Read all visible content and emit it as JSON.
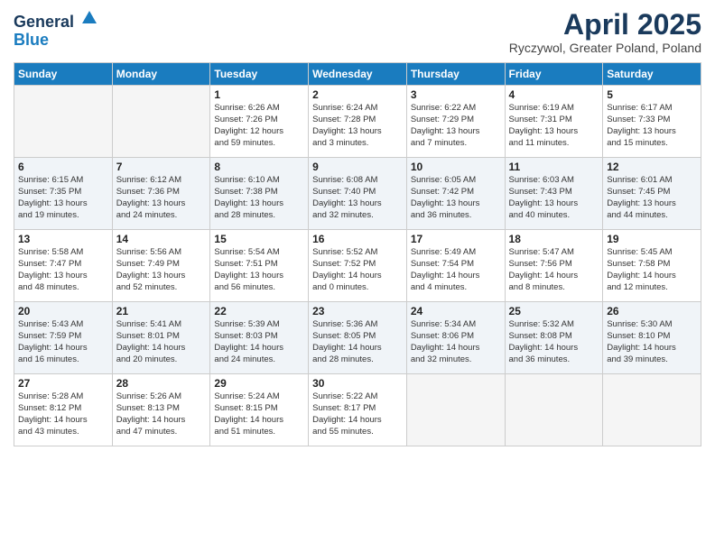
{
  "header": {
    "logo_general": "General",
    "logo_blue": "Blue",
    "month": "April 2025",
    "location": "Ryczywol, Greater Poland, Poland"
  },
  "weekdays": [
    "Sunday",
    "Monday",
    "Tuesday",
    "Wednesday",
    "Thursday",
    "Friday",
    "Saturday"
  ],
  "weeks": [
    [
      {
        "day": "",
        "lines": []
      },
      {
        "day": "",
        "lines": []
      },
      {
        "day": "1",
        "lines": [
          "Sunrise: 6:26 AM",
          "Sunset: 7:26 PM",
          "Daylight: 12 hours",
          "and 59 minutes."
        ]
      },
      {
        "day": "2",
        "lines": [
          "Sunrise: 6:24 AM",
          "Sunset: 7:28 PM",
          "Daylight: 13 hours",
          "and 3 minutes."
        ]
      },
      {
        "day": "3",
        "lines": [
          "Sunrise: 6:22 AM",
          "Sunset: 7:29 PM",
          "Daylight: 13 hours",
          "and 7 minutes."
        ]
      },
      {
        "day": "4",
        "lines": [
          "Sunrise: 6:19 AM",
          "Sunset: 7:31 PM",
          "Daylight: 13 hours",
          "and 11 minutes."
        ]
      },
      {
        "day": "5",
        "lines": [
          "Sunrise: 6:17 AM",
          "Sunset: 7:33 PM",
          "Daylight: 13 hours",
          "and 15 minutes."
        ]
      }
    ],
    [
      {
        "day": "6",
        "lines": [
          "Sunrise: 6:15 AM",
          "Sunset: 7:35 PM",
          "Daylight: 13 hours",
          "and 19 minutes."
        ]
      },
      {
        "day": "7",
        "lines": [
          "Sunrise: 6:12 AM",
          "Sunset: 7:36 PM",
          "Daylight: 13 hours",
          "and 24 minutes."
        ]
      },
      {
        "day": "8",
        "lines": [
          "Sunrise: 6:10 AM",
          "Sunset: 7:38 PM",
          "Daylight: 13 hours",
          "and 28 minutes."
        ]
      },
      {
        "day": "9",
        "lines": [
          "Sunrise: 6:08 AM",
          "Sunset: 7:40 PM",
          "Daylight: 13 hours",
          "and 32 minutes."
        ]
      },
      {
        "day": "10",
        "lines": [
          "Sunrise: 6:05 AM",
          "Sunset: 7:42 PM",
          "Daylight: 13 hours",
          "and 36 minutes."
        ]
      },
      {
        "day": "11",
        "lines": [
          "Sunrise: 6:03 AM",
          "Sunset: 7:43 PM",
          "Daylight: 13 hours",
          "and 40 minutes."
        ]
      },
      {
        "day": "12",
        "lines": [
          "Sunrise: 6:01 AM",
          "Sunset: 7:45 PM",
          "Daylight: 13 hours",
          "and 44 minutes."
        ]
      }
    ],
    [
      {
        "day": "13",
        "lines": [
          "Sunrise: 5:58 AM",
          "Sunset: 7:47 PM",
          "Daylight: 13 hours",
          "and 48 minutes."
        ]
      },
      {
        "day": "14",
        "lines": [
          "Sunrise: 5:56 AM",
          "Sunset: 7:49 PM",
          "Daylight: 13 hours",
          "and 52 minutes."
        ]
      },
      {
        "day": "15",
        "lines": [
          "Sunrise: 5:54 AM",
          "Sunset: 7:51 PM",
          "Daylight: 13 hours",
          "and 56 minutes."
        ]
      },
      {
        "day": "16",
        "lines": [
          "Sunrise: 5:52 AM",
          "Sunset: 7:52 PM",
          "Daylight: 14 hours",
          "and 0 minutes."
        ]
      },
      {
        "day": "17",
        "lines": [
          "Sunrise: 5:49 AM",
          "Sunset: 7:54 PM",
          "Daylight: 14 hours",
          "and 4 minutes."
        ]
      },
      {
        "day": "18",
        "lines": [
          "Sunrise: 5:47 AM",
          "Sunset: 7:56 PM",
          "Daylight: 14 hours",
          "and 8 minutes."
        ]
      },
      {
        "day": "19",
        "lines": [
          "Sunrise: 5:45 AM",
          "Sunset: 7:58 PM",
          "Daylight: 14 hours",
          "and 12 minutes."
        ]
      }
    ],
    [
      {
        "day": "20",
        "lines": [
          "Sunrise: 5:43 AM",
          "Sunset: 7:59 PM",
          "Daylight: 14 hours",
          "and 16 minutes."
        ]
      },
      {
        "day": "21",
        "lines": [
          "Sunrise: 5:41 AM",
          "Sunset: 8:01 PM",
          "Daylight: 14 hours",
          "and 20 minutes."
        ]
      },
      {
        "day": "22",
        "lines": [
          "Sunrise: 5:39 AM",
          "Sunset: 8:03 PM",
          "Daylight: 14 hours",
          "and 24 minutes."
        ]
      },
      {
        "day": "23",
        "lines": [
          "Sunrise: 5:36 AM",
          "Sunset: 8:05 PM",
          "Daylight: 14 hours",
          "and 28 minutes."
        ]
      },
      {
        "day": "24",
        "lines": [
          "Sunrise: 5:34 AM",
          "Sunset: 8:06 PM",
          "Daylight: 14 hours",
          "and 32 minutes."
        ]
      },
      {
        "day": "25",
        "lines": [
          "Sunrise: 5:32 AM",
          "Sunset: 8:08 PM",
          "Daylight: 14 hours",
          "and 36 minutes."
        ]
      },
      {
        "day": "26",
        "lines": [
          "Sunrise: 5:30 AM",
          "Sunset: 8:10 PM",
          "Daylight: 14 hours",
          "and 39 minutes."
        ]
      }
    ],
    [
      {
        "day": "27",
        "lines": [
          "Sunrise: 5:28 AM",
          "Sunset: 8:12 PM",
          "Daylight: 14 hours",
          "and 43 minutes."
        ]
      },
      {
        "day": "28",
        "lines": [
          "Sunrise: 5:26 AM",
          "Sunset: 8:13 PM",
          "Daylight: 14 hours",
          "and 47 minutes."
        ]
      },
      {
        "day": "29",
        "lines": [
          "Sunrise: 5:24 AM",
          "Sunset: 8:15 PM",
          "Daylight: 14 hours",
          "and 51 minutes."
        ]
      },
      {
        "day": "30",
        "lines": [
          "Sunrise: 5:22 AM",
          "Sunset: 8:17 PM",
          "Daylight: 14 hours",
          "and 55 minutes."
        ]
      },
      {
        "day": "",
        "lines": []
      },
      {
        "day": "",
        "lines": []
      },
      {
        "day": "",
        "lines": []
      }
    ]
  ]
}
